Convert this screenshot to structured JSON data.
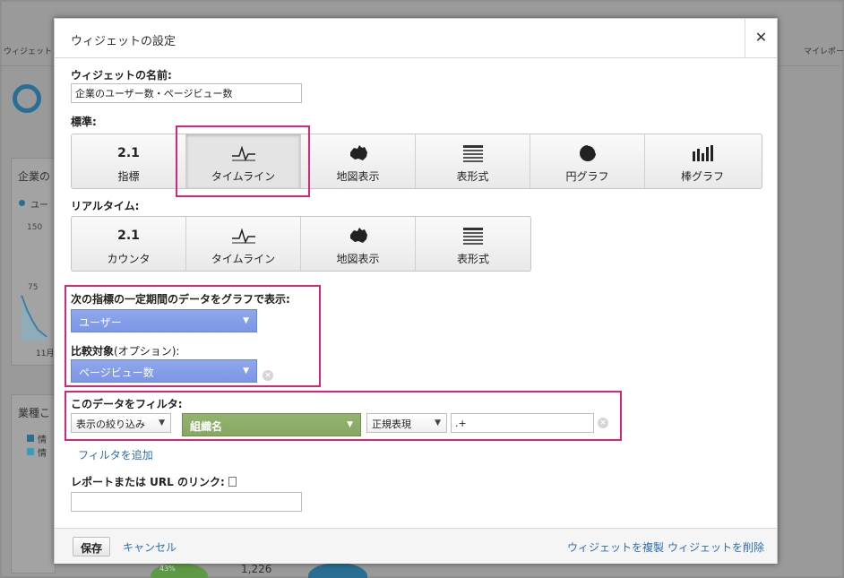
{
  "background": {
    "tab_left": "ウィジェット",
    "tab_right": "マイレポー",
    "widget1_title": "企業の",
    "widget1_legend": "ユー",
    "axis_150": "150",
    "axis_75": "75",
    "month": "11月",
    "widget2_title": "業種こ",
    "widget2_item1": "情",
    "widget2_item2": "情",
    "pie_pct": "43%",
    "count": "1,226",
    "colors": {
      "accent": "#2a6f93",
      "green": "#5e9a45"
    }
  },
  "dialog": {
    "title": "ウィジェットの設定",
    "close_icon": "close-icon",
    "name_label": "ウィジェットの名前:",
    "name_value": "企業のユーザー数・ページビュー数",
    "standard_label": "標準:",
    "standard_types": [
      {
        "icon_text": "2.1",
        "icon": "metric-number-icon",
        "label": "指標"
      },
      {
        "icon": "timeline-icon",
        "label": "タイムライン",
        "selected": true
      },
      {
        "icon": "map-australia-icon",
        "label": "地図表示"
      },
      {
        "icon": "table-icon",
        "label": "表形式"
      },
      {
        "icon": "pie-chart-icon",
        "label": "円グラフ"
      },
      {
        "icon": "bar-chart-icon",
        "label": "棒グラフ"
      }
    ],
    "realtime_label": "リアルタイム:",
    "realtime_types": [
      {
        "icon_text": "2.1",
        "icon": "metric-number-icon",
        "label": "カウンタ"
      },
      {
        "icon": "timeline-icon",
        "label": "タイムライン"
      },
      {
        "icon": "map-australia-icon",
        "label": "地図表示"
      },
      {
        "icon": "table-icon",
        "label": "表形式"
      }
    ],
    "metric_label": "次の指標の一定期間のデータをグラフで表示:",
    "metric_value": "ユーザー",
    "compare_label": "比較対象",
    "compare_label_suffix": "(オプション):",
    "compare_value": "ページビュー数",
    "filter_label": "このデータをフィルタ:",
    "filter_mode": "表示の絞り込み",
    "filter_dimension": "組織名",
    "filter_match": "正規表現",
    "filter_value": ".+",
    "add_filter": "フィルタを追加",
    "link_label": "レポートまたは URL のリンク:",
    "link_value": "",
    "save": "保存",
    "cancel": "キャンセル",
    "duplicate": "ウィジェットを複製",
    "delete": "ウィジェットを削除",
    "colors": {
      "highlight": "#d8247a",
      "dropdown_blue": "#8fa7ec",
      "dropdown_green": "#93b46e",
      "link": "#2a6fb0"
    }
  }
}
